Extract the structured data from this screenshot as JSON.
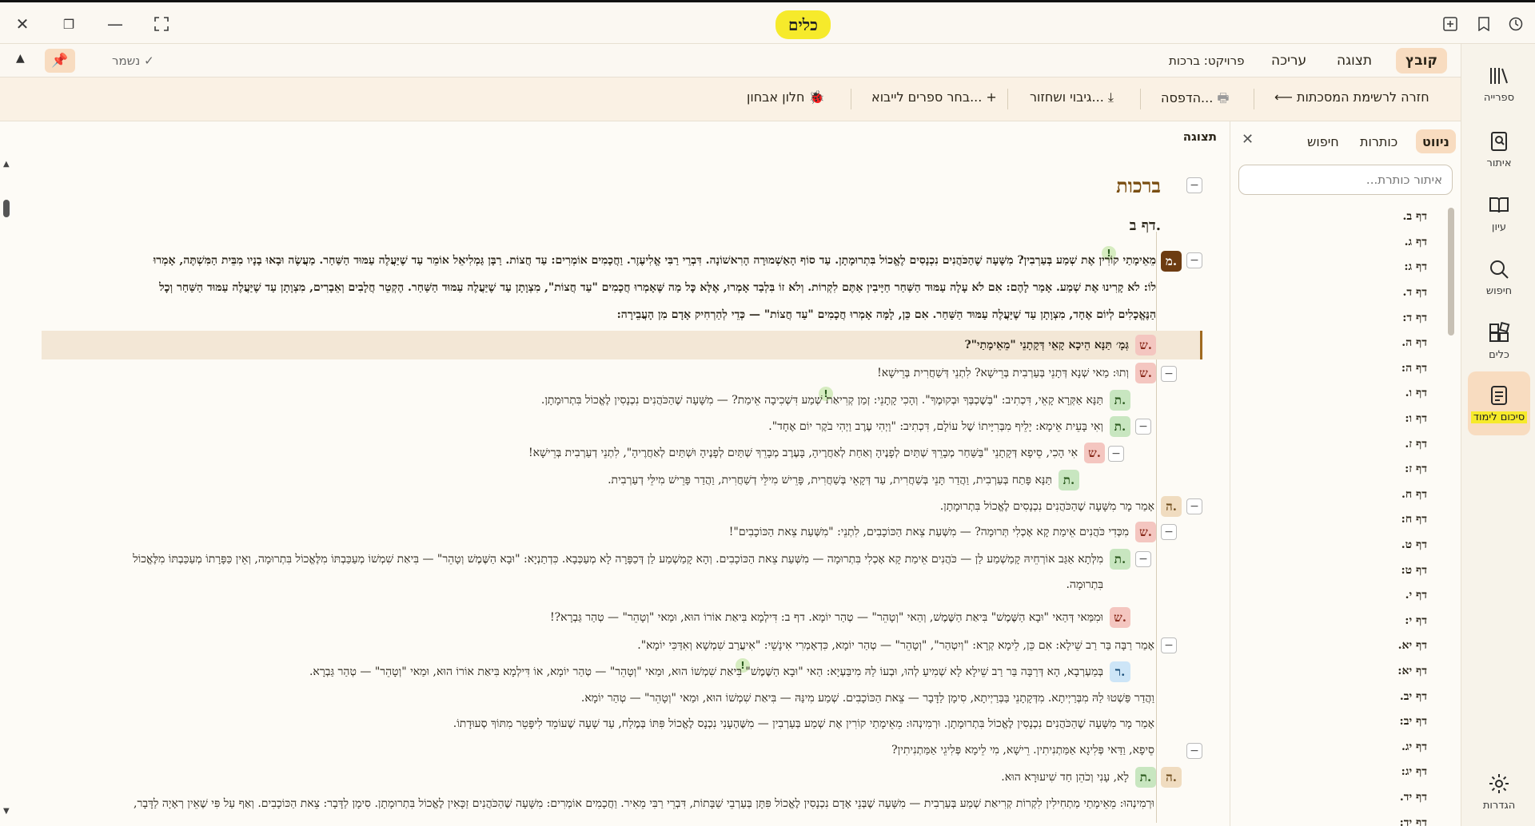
{
  "app": {
    "title": "כלים"
  },
  "menubar": {
    "items": [
      {
        "label": "קובץ",
        "active": true
      },
      {
        "label": "תצוגה",
        "active": false
      },
      {
        "label": "עריכה",
        "active": false
      }
    ],
    "project": "פרויקט: ברכות",
    "saved": "נשמר ✓"
  },
  "toolbar": {
    "back": "⟵ חזרה לרשימת המסכתות",
    "print": "הדפסה...",
    "backup": "גיבוי ושחזור...",
    "import": "בחר ספרים לייבוא...",
    "debug": "חלון אבחון"
  },
  "sidebar": {
    "items": [
      {
        "label": "ספרייה",
        "icon": "library-icon"
      },
      {
        "label": "איתור",
        "icon": "locate-icon"
      },
      {
        "label": "עיון",
        "icon": "book-open-icon"
      },
      {
        "label": "חיפוש",
        "icon": "search-icon"
      },
      {
        "label": "כלים",
        "icon": "tools-icon"
      },
      {
        "label": "סיכום לימוד",
        "icon": "notes-icon",
        "active": true
      },
      {
        "label": "הגדרות",
        "icon": "gear-icon"
      }
    ]
  },
  "navpanel": {
    "tabs": [
      {
        "label": "ניווט",
        "active": true
      },
      {
        "label": "כותרות",
        "active": false
      },
      {
        "label": "חיפוש",
        "active": false
      }
    ],
    "search_placeholder": "איתור כותרת...",
    "items": [
      "דף ב.",
      "דף ג.",
      "דף ג:",
      "דף ד.",
      "דף ד:",
      "דף ה.",
      "דף ה:",
      "דף ו.",
      "דף ו:",
      "דף ז.",
      "דף ז:",
      "דף ח.",
      "דף ח:",
      "דף ט.",
      "דף ט:",
      "דף י.",
      "דף י:",
      "דף יא.",
      "דף יא:",
      "דף יב.",
      "דף יב:",
      "דף יג.",
      "דף יג:",
      "דף יד.",
      "דף יד:"
    ]
  },
  "content": {
    "header": "תצוגה",
    "tractate": "ברכות",
    "daf": "דף ב.",
    "mishna": [
      "מֵאֵימָתַי  קוֹרִין אֶת שְׁמַע בְּעַרְבִין? מִשָּׁעָה שֶׁהַכֹּהֲנִים נִכְנָסִים לֶאֱכוֹל בִּתְרוּמָתָן. עַד סוֹף הָאַשְׁמוּרָה הָרִאשׁוֹנָה. דִּבְרֵי רַבִּי אֱלִיעֶזֶר. וַחֲכָמִים אוֹמְרִים: עַד חֲצוֹת. רַבָּן גַּמְלִיאֵל אוֹמֵר עַד שֶׁיַּעֲלֶה עַמּוּד הַשַּׁחַר. מַעֲשֶׂה וּבָאוּ בָנָיו מִבֵּית הַמִּשְׁתֶּה, אָמְרוּ",
      "לוֹ: לֹא קָרִינוּ אֶת שְׁמַע. אָמַר לָהֶם: אִם לֹא עָלָה עַמּוּד הַשַּׁחַר חַיָּיבִין אַתֶּם לִקְרוֹת. וְלֹא זוֹ בִּלְבַד אָמְרוּ, אֶלָּא כׇּל מַה שֶּׁאָמְרוּ חֲכָמִים \"עַד חֲצוֹת\", מִצְוָתָן עַד שֶׁיַּעֲלֶה עַמּוּד הַשַּׁחַר. הֶקְטֵר חֲלָבִים וְאֵבָרִים, מִצְוָתָן עַד שֶׁיַּעֲלֶה עַמּוּד הַשַּׁחַר וְכׇל",
      "הַנֶּאֱכָלִים לְיוֹם אֶחָד, מִצְוָתָן עַד שֶׁיַּעֲלֶה עַמּוּד הַשַּׁחַר. אִם כֵּן, לָמָּה אָמְרוּ חֲכָמִים \"עַד חֲצוֹת\" — כְּדֵי לְהַרְחִיק אָדָם מִן הָעֲבֵירָה:"
    ],
    "badges": {
      "m": "מ.",
      "s": "ש.",
      "t": "ת.",
      "h": "ה.",
      "r": "ר."
    },
    "gemara_rows": [
      "גְּמָ׳ תַּנָּא הֵיכָא קָאֵי דְּקָתָנֵי \"מֵאֵימָתַי\"?",
      "וְתוּ: מַאי שְׁנָא דְּתָנֵי בְּעַרְבִית בְּרֵישָׁא? לִתְנֵי דְּשַׁחֲרִית בְּרֵישָׁא!",
      "תַּנָּא אַקְּרָא קָאֵי, דִּכְתִיב: \"בְּשׇׁכְבְּךָ וּבְקוּמֶךָ\". וְהָכִי קָתָנֵי: זְמַן  קְרִיאַת שְׁמַע דִּשְׁכִיבָה אֵימַת? — מִשָּׁעָה שֶׁהַכֹּהֲנִים נִכְנָסִין לֶאֱכוֹל בִּתְרוּמָתָן.",
      "וְאִי בָּעֵית אֵימָא: יָלֵיף מִבְּרִיָּיתוֹ שֶׁל עוֹלָם, דִּכְתִיב: \"וַיְהִי עֶרֶב וַיְהִי בֹקֶר יוֹם אֶחָד\".",
      "אִי הָכִי, סֵיפָא דְּקָתָנֵי \"בַּשַּׁחַר מְבָרֵךְ שְׁתַּיִם לְפָנֶיהָ וְאַחַת לְאַחֲרֶיהָ, בָּעֶרֶב מְבָרֵךְ שְׁתַּיִם לְפָנֶיהָ וּשְׁתַּיִם לְאַחֲרֶיהָ\", לִתְנֵי דְעַרְבִית בְּרֵישָׁא!",
      "תַּנָּא פָּתַח בְּעַרְבִית, וַהֲדַר תָּנֵי בְּשַׁחֲרִית, עַד דְּקָאֵי בְּשַׁחֲרִית, פָּרֵישׁ מִילֵּי דְשַׁחֲרִית, וַהֲדַר פָּרֵישׁ מִילֵּי דְעַרְבִית.",
      "אָמַר מָר מִשָּׁעָה שֶׁהַכֹּהֲנִים נִכְנָסִים לֶאֱכוֹל בִּתְרוּמָתָן.",
      "מִכְּדִי כֹּהֲנִים אֵימַת קָא אָכְלִי תְּרוּמָה? — מִשְּׁעַת צֵאת הַכּוֹכָבִים, לִתְנֵי: \"מִשְּׁעַת צֵאת הַכּוֹכָבִים\"!",
      "מִלְּתָא אַגַּב אוֹרְחֵיהּ קָמַשְׁמַע לַן — כֹּהֲנִים אֵימַת קָא אָכְלִי בִּתְרוּמָה — מִשְּׁעַת צֵאת הַכּוֹכָבִים. וְהָא קָמַשְׁמַע לַן דְּכַפָּרָה לָא מְעַכְּבָא. כִּדְתַנְיָא: \"וּבָא הַשֶּׁמֶשׁ וְטָהֵר\" — בִּיאַת שִׁמְשׁוֹ מְעַכַּבְתּוֹ מִלֶּאֱכוֹל בִּתְרוּמָה, וְאֵין כַּפָּרָתוֹ מְעַכַּבְתּוֹ מִלֶּאֱכוֹל",
      "בִּתְרוּמָה.",
      "וּמִמַּאי דְּהַאי \"וּבָא הַשֶּׁמֶשׁ\" בִּיאַת הַשֶּׁמֶשׁ, וְהַאי \"וְטָהֵר\" — טְהַר יוֹמָא. דף ב: דִּילְמָא בִּיאַת אוֹרוֹ הוּא, וּמַאי \"וְטָהֵר\" — טְהַר גַּבְרָא?!",
      "אָמַר רַבָּה בַּר רַב שֵׁילָא: אִם כֵּן, לֵימָא קְרָא: \"וְיִטְהַר\", \"וְטָהֵר\" — טְהַר יוֹמָא, כִּדְאָמְרִי אִינָשֵׁי: \"אִיעֲרַב שִׁמְשָׁא וְאִדַּכִּי יוֹמָא\".",
      "בְּמַעְרְבָא, הָא דְּרַבָּה בַּר רַב שֵׁילָא לָא שְׁמִיעַ לְהוּ, וּבְעוֹ לַהּ מִיבַּעְיָא: הַאי \"וּבָא  הַשֶּׁמֶשׁ\" בִּיאַת שִׁמְשׁוֹ הוּא, וּמַאי \"וְטָהֵר\" — טְהַר יוֹמָא, אוֹ דִּילְמָא בִּיאַת אוֹרוֹ הוּא, וּמַאי \"וְטָהֵר\" — טְהַר גַּבְרָא.",
      "וַהֲדַר פַּשְׁטוּ לַהּ מִבְּרַיְיתָא. מִדְּקָתָנֵי בַּבְּרַיְיתָא, סִימָן לַדָּבָר — צֵאת הַכּוֹכָבִים. שְׁמַע מִינַּהּ — בִּיאַת שִׁמְשׁוֹ הוּא, וּמַאי \"וְטָהֵר\" — טְהַר יוֹמָא.",
      "אָמַר מָר מִשָּׁעָה שֶׁהַכֹּהֲנִים נִכְנָסִין לֶאֱכוֹל בִּתְרוּמָתָן. וּרְמִינְהוּ: מֵאֵימָתַי קוֹרִין אֶת שְׁמַע בְּעַרְבִין — מִשֶּׁהֶעָנִי נִכְנָס לֶאֱכוֹל פִּתּוֹ בְּמֶלַח, עַד שָׁעָה שֶׁעוֹמֵד לִיפָּטֵר מִתּוֹךְ סְעוּדָתוֹ.",
      "סֵיפָא, וַדַּאי פְּלִיגָא אַמַּתְנִיתִין. רֵישָׁא, מִי לֵימָא פְּלִיגֵי אַמַּתְנִיתִין?",
      "לָא, עָנִי וְכֹהֵן חַד שִׁיעוּרָא הוּא.",
      "וּרְמִינְהוּ: מֵאֵימָתַי מַתְחִילִין לִקְרוֹת קְרִיאַת שְׁמַע בְּעַרְבִית — מִשָּׁעָה שֶׁבְּנֵי אָדָם נִכְנָסִין לֶאֱכוֹל פִּתָּן בְּעַרְבֵי שַׁבָּתוֹת, דִּבְרֵי רַבִּי מֵאִיר. וַחֲכָמִים אוֹמְרִים: מִשָּׁעָה שֶׁהַכֹּהֲנִים זַכָּאִין לֶאֱכוֹל בִּתְרוּמָתָן. סִימָן לַדָּבָר: צֵאת הַכּוֹכָבִים. וְאַף עַל פִּי שֶׁאֵין רְאָיָה לַדָּבָר,"
    ],
    "exclaim": "!"
  },
  "colors": {
    "accent_highlight": "#f6ea2b",
    "active_bg": "#f8dcc0",
    "tractate_title": "#7a4e12"
  }
}
